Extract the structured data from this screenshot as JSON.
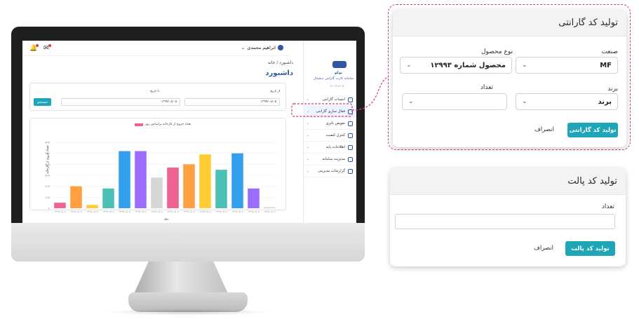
{
  "app": {
    "user_name": "ابراهیم محمدی",
    "logo_name": "توکو",
    "logo_subtitle": "سامانه کارت گارانتی دیجیتال",
    "version": "۱۴۰۲/۱۲/۰۵",
    "breadcrumb": "داشبورد / خانه",
    "page_title": "داشبورد",
    "menu": [
      {
        "label": "انتساب گارانتی",
        "active": false
      },
      {
        "label": "فعال سازی گارانتی",
        "active": true
      },
      {
        "label": "تعویض باتری",
        "active": false
      },
      {
        "label": "کنترل کیفیت",
        "active": false
      },
      {
        "label": "اطلاعات پایه",
        "active": false
      },
      {
        "label": "مدیریت سامانه",
        "active": false
      },
      {
        "label": "گزارشات مدیریتی",
        "active": false
      }
    ],
    "filter": {
      "from_label": "از تاریخ",
      "from_value": "۱۳۹۹/۰۸/۰۵",
      "to_label": "تا تاریخ",
      "to_value": "۱۳۹۹/۰۸/۰۵",
      "search_button": "جستجو"
    },
    "icons": {
      "bell": "bell-icon",
      "mail": "mail-icon",
      "user": "user-icon",
      "calendar": "calendar-icon"
    }
  },
  "chart_data": {
    "type": "bar",
    "title": "",
    "legend": [
      "تعداد خروج از کارخانه براساس روز"
    ],
    "ylabel": "تعداد خروج از کارخانه",
    "xlabel": "روز",
    "ylim": [
      0,
      600
    ],
    "yticks": [
      "0",
      "100",
      "200",
      "300",
      "400",
      "500",
      "600"
    ],
    "categories": [
      "۱۳۹۹/۰۸/۰۵",
      "۱۳۹۹/۰۸/۰۵",
      "۱۳۹۹/۰۸/۰۵",
      "۱۳۹۹/۰۸/۰۵",
      "۱۳۹۹/۰۸/۰۵",
      "۱۳۹۹/۰۸/۰۵",
      "۱۳۹۹/۰۸/۰۵",
      "۱۳۹۹/۰۸/۰۵",
      "۱۳۹۹/۰۸/۰۵",
      "۱۳۹۹/۰۸/۰۵",
      "۱۳۹۹/۰۸/۰۵",
      "۱۳۹۹/۰۸/۰۵",
      "۱۳۹۹/۰۸/۰۵",
      "۱۳۹۹/۰۸/۰۵"
    ],
    "values": [
      50,
      200,
      30,
      180,
      520,
      520,
      280,
      370,
      400,
      490,
      350,
      500,
      180,
      10
    ],
    "colors": [
      "#f06292",
      "#ffa040",
      "#ffcc33",
      "#4dc0b5",
      "#33a0ee",
      "#9c6cff",
      "#d6d6d6",
      "#f06292",
      "#ffa040",
      "#ffcc33",
      "#4dc0b5",
      "#33a0ee",
      "#9c6cff",
      "#d6d6d6"
    ],
    "grid": true
  },
  "warranty_dialog": {
    "title": "تولید کد گارانتی",
    "company_label": "صنعت",
    "company_value": "MF",
    "product_type_label": "نوع محصول",
    "product_type_value": "محصول شماره ۱۲۹۹۳",
    "brand_label": "برند",
    "brand_value": "برند",
    "count_label": "تعداد",
    "count_value": "",
    "submit": "تولید کد گارانتی",
    "cancel": "انصراف"
  },
  "pallet_dialog": {
    "title": "تولید کد پالت",
    "count_label": "تعداد",
    "count_value": "",
    "submit": "تولید کد پالت",
    "cancel": "انصراف"
  },
  "colors": {
    "accent": "#1fa5b8",
    "brand": "#2f57a5",
    "highlight": "#d63b72"
  }
}
